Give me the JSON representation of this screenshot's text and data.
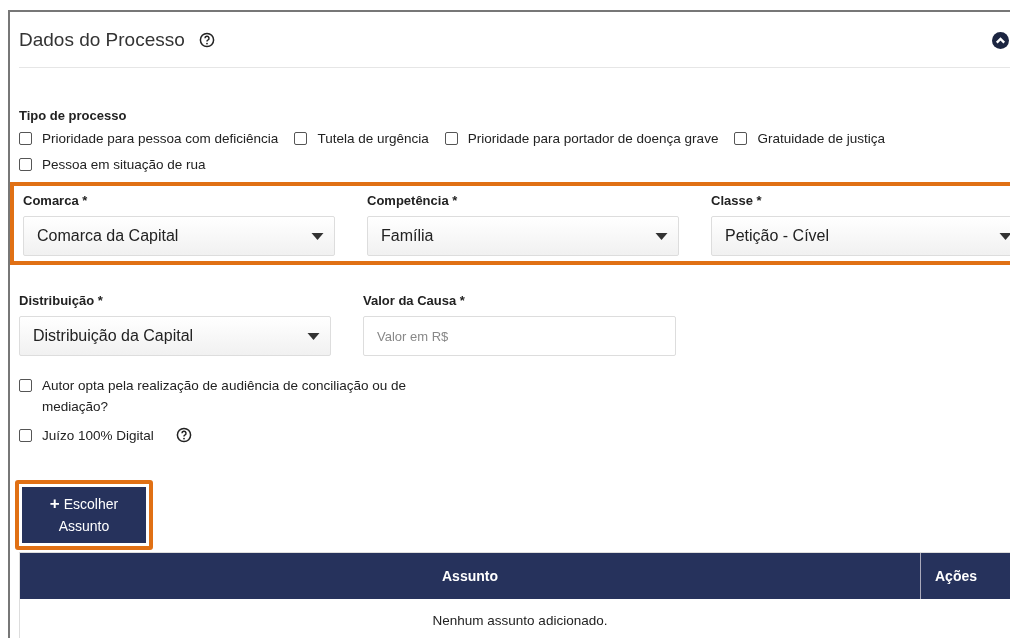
{
  "panel": {
    "title": "Dados do Processo",
    "expanded": true
  },
  "process_type": {
    "label": "Tipo de processo",
    "options": [
      {
        "label": "Prioridade para pessoa com deficiência",
        "checked": false
      },
      {
        "label": "Tutela de urgência",
        "checked": false
      },
      {
        "label": "Prioridade para portador de doença grave",
        "checked": false
      },
      {
        "label": "Gratuidade de justiça",
        "checked": false
      },
      {
        "label": "Pessoa em situação de rua",
        "checked": false
      }
    ]
  },
  "highlighted_row": {
    "highlighted": true,
    "fields": [
      {
        "label": "Comarca *",
        "value": "Comarca da Capital"
      },
      {
        "label": "Competência *",
        "value": "Família"
      },
      {
        "label": "Classe *",
        "value": "Petição - Cível"
      }
    ]
  },
  "second_row": [
    {
      "kind": "select",
      "label": "Distribuição *",
      "value": "Distribuição da Capital"
    },
    {
      "kind": "input",
      "label": "Valor da Causa *",
      "placeholder": "Valor em R$"
    }
  ],
  "options": [
    {
      "label": "Autor opta pela realização de audiência de conciliação ou de mediação?",
      "checked": false,
      "help": false
    },
    {
      "label": "Juízo 100% Digital",
      "checked": false,
      "help": true
    }
  ],
  "choose_button": {
    "icon": "+",
    "label": "Escolher Assunto",
    "highlighted": true
  },
  "table": {
    "columns": [
      "Assunto",
      "Ações"
    ],
    "empty_message": "Nenhum assunto adicionado."
  }
}
